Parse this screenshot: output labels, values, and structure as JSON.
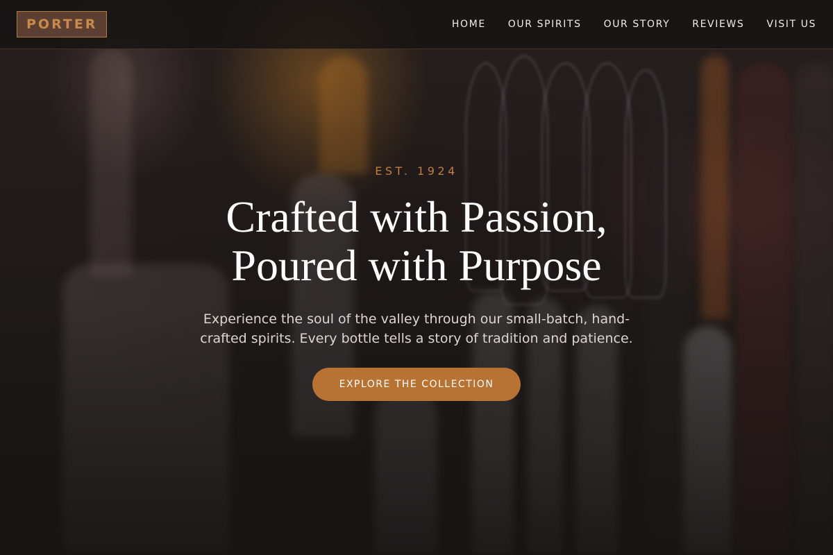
{
  "brand": {
    "logo_text": "PORTER"
  },
  "nav": {
    "items": [
      {
        "label": "HOME"
      },
      {
        "label": "OUR SPIRITS"
      },
      {
        "label": "OUR STORY"
      },
      {
        "label": "REVIEWS"
      },
      {
        "label": "VISIT US"
      }
    ]
  },
  "hero": {
    "eyebrow": "EST. 1924",
    "headline_line1": "Crafted with Passion,",
    "headline_line2": "Poured with Purpose",
    "subtext": "Experience the soul of the valley through our small-batch, hand-crafted spirits. Every bottle tells a story of tradition and patience.",
    "cta_label": "EXPLORE THE COLLECTION",
    "background_image": "blurred bar shelf with bottles and glasses"
  },
  "colors": {
    "accent": "#b87333",
    "eyebrow": "#c27e3e",
    "logo_bg": "#5b3f33",
    "nav_bg": "#161414"
  }
}
